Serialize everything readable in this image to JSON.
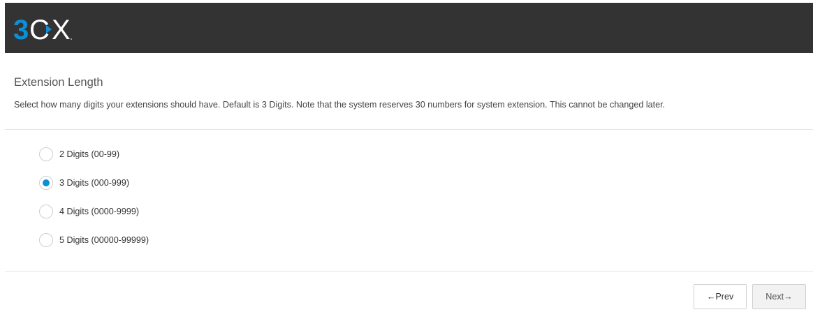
{
  "header": {
    "logo_text": "3CX"
  },
  "section": {
    "title": "Extension Length",
    "description": "Select how many digits your extensions should have. Default is 3 Digits. Note that the system reserves 30 numbers for system extension. This cannot be changed later."
  },
  "options": [
    {
      "label": "2 Digits (00-99)",
      "selected": false
    },
    {
      "label": "3 Digits (000-999)",
      "selected": true
    },
    {
      "label": "4 Digits (0000-9999)",
      "selected": false
    },
    {
      "label": "5 Digits (00000-99999)",
      "selected": false
    }
  ],
  "buttons": {
    "prev_label": "←Prev",
    "next_label": "Next→"
  },
  "colors": {
    "header_bg": "#333333",
    "logo_accent": "#0b8fd6",
    "radio_selected": "#0b8fd6"
  }
}
